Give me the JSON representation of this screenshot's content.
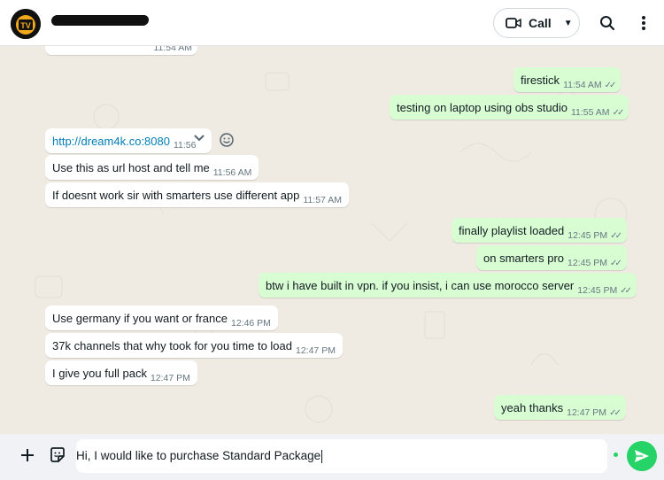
{
  "header": {
    "avatar_text": "TV",
    "call_label": "Call"
  },
  "colors": {
    "incoming_bubble": "#ffffff",
    "outgoing_bubble": "#d9fdd3",
    "accent_green": "#25d366",
    "tick_color": "#667781"
  },
  "icons": {
    "video": "video-camera-icon",
    "search": "search-icon",
    "menu": "kebab-menu-icon",
    "plus": "plus-icon",
    "sticker": "sticker-icon",
    "send": "send-icon",
    "emoji": "emoji-icon",
    "dropdown": "chevron-down-icon"
  },
  "messages": [
    {
      "side": "in",
      "text": "",
      "time": "11:54 AM"
    },
    {
      "side": "out",
      "text": "firestick",
      "time": "11:54 AM"
    },
    {
      "side": "out",
      "text": "testing on laptop using obs studio",
      "time": "11:55 AM"
    },
    {
      "side": "in",
      "text": "http://dream4k.co:8080",
      "time": "11:56"
    },
    {
      "side": "in",
      "text": "Use this as url host and tell me",
      "time": "11:56 AM"
    },
    {
      "side": "in",
      "text": "If doesnt work sir with smarters use different app",
      "time": "11:57 AM"
    },
    {
      "side": "out",
      "text": "finally playlist loaded",
      "time": "12:45 PM"
    },
    {
      "side": "out",
      "text": "on smarters pro",
      "time": "12:45 PM"
    },
    {
      "side": "out",
      "text": "btw i have  built in vpn. if you insist, i can use morocco server",
      "time": "12:45 PM"
    },
    {
      "side": "in",
      "text": "Use germany if you want or france",
      "time": "12:46 PM"
    },
    {
      "side": "in",
      "text": "37k channels that why took for you time to load",
      "time": "12:47 PM"
    },
    {
      "side": "in",
      "text": "I give you full pack",
      "time": "12:47 PM"
    },
    {
      "side": "out",
      "text": "yeah thanks",
      "time": "12:47 PM"
    }
  ],
  "composer": {
    "text": "Hi, I would like to purchase Standard Package"
  }
}
